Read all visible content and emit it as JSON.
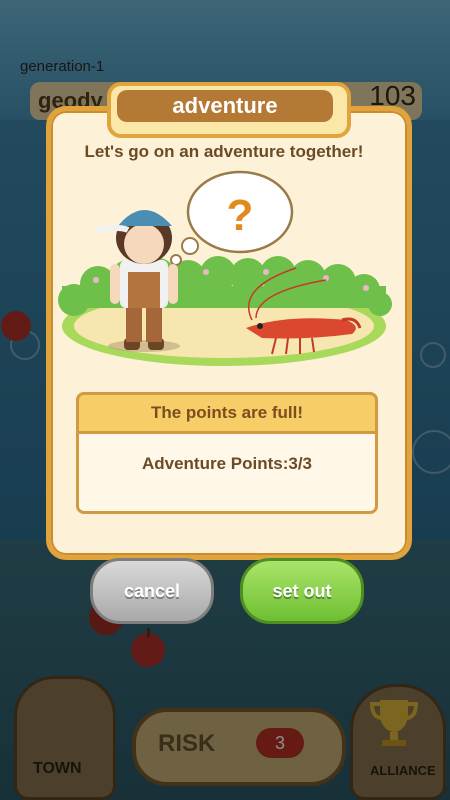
{
  "background": {
    "generation_label": "generation-1",
    "player_name": "geody",
    "score": "103",
    "risk_label": "RISK",
    "risk_count": "3",
    "town_label": "TOWN",
    "alliance_label": "ALLIANCE"
  },
  "dialog": {
    "title": "adventure",
    "subtitle": "Let's go on an adventure together!",
    "thought_symbol": "?",
    "points_header": "The points are full!",
    "points_text": "Adventure Points:3/3",
    "cancel_label": "cancel",
    "setout_label": "set out"
  },
  "colors": {
    "frame": "#e1a33b",
    "title_bar": "#b47a35",
    "cancel": "#a9a9a9",
    "setout": "#6fbf32",
    "risk_badge": "#b83226"
  }
}
